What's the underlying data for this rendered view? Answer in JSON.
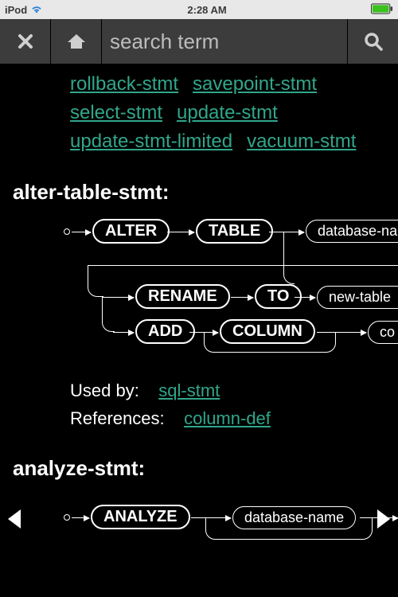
{
  "status": {
    "carrier": "iPod",
    "time": "2:28 AM"
  },
  "search": {
    "placeholder": "search term"
  },
  "links_top": [
    "rollback-stmt",
    "savepoint-stmt",
    "select-stmt",
    "update-stmt",
    "update-stmt-limited",
    "vacuum-stmt"
  ],
  "section1": {
    "title": "alter-table-stmt:",
    "nodes": {
      "alter": "ALTER",
      "table": "TABLE",
      "database": "database-name",
      "rename": "RENAME",
      "to": "TO",
      "newtable": "new-table",
      "add": "ADD",
      "column": "COLUMN",
      "co": "co"
    },
    "used_by_label": "Used by:",
    "used_by_link": "sql-stmt",
    "references_label": "References:",
    "references_link": "column-def"
  },
  "section2": {
    "title": "analyze-stmt:",
    "nodes": {
      "analyze": "ANALYZE",
      "database": "database-name"
    }
  }
}
